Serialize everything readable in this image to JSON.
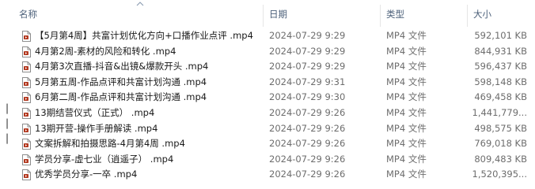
{
  "columns": {
    "name": "名称",
    "date": "日期",
    "type": "类型",
    "size": "大小"
  },
  "sort": {
    "column": "name",
    "direction": "ascending",
    "icon": "chevron-up-icon"
  },
  "file_icon": "video-file-icon",
  "files": [
    {
      "name": "【5月第4周】共富计划优化方向+口播作业点评 .mp4",
      "date": "2024-07-29 9:29",
      "type": "MP4 文件",
      "size": "592,101 KB"
    },
    {
      "name": "4月第2周-素材的风险和转化 .mp4",
      "date": "2024-07-29 9:29",
      "type": "MP4 文件",
      "size": "844,931 KB"
    },
    {
      "name": "4月第3次直播-抖音&出镜&爆款开头 .mp4",
      "date": "2024-07-29 9:29",
      "type": "MP4 文件",
      "size": "596,437 KB"
    },
    {
      "name": "5月第五周-作品点评和共富计划沟通 .mp4",
      "date": "2024-07-29 9:31",
      "type": "MP4 文件",
      "size": "598,148 KB"
    },
    {
      "name": "6月第二周-作品点评和共富计划沟通 .mp4",
      "date": "2024-07-29 9:30",
      "type": "MP4 文件",
      "size": "469,458 KB"
    },
    {
      "name": "13期结营仪式（正式） .mp4",
      "date": "2024-07-29 9:26",
      "type": "MP4 文件",
      "size": "1,441,779..."
    },
    {
      "name": "13期开营-操作手册解读 .mp4",
      "date": "2024-07-29 9:26",
      "type": "MP4 文件",
      "size": "498,575 KB"
    },
    {
      "name": "文案拆解和拍摄思路-4月第4周 .mp4",
      "date": "2024-07-29 9:26",
      "type": "MP4 文件",
      "size": "769,018 KB"
    },
    {
      "name": "学员分享-虚七业（逍遥子） .mp4",
      "date": "2024-07-29 9:26",
      "type": "MP4 文件",
      "size": "809,483 KB"
    },
    {
      "name": "优秀学员分享-一卒 .mp4",
      "date": "2024-07-29 9:26",
      "type": "MP4 文件",
      "size": "1,520,395..."
    }
  ]
}
